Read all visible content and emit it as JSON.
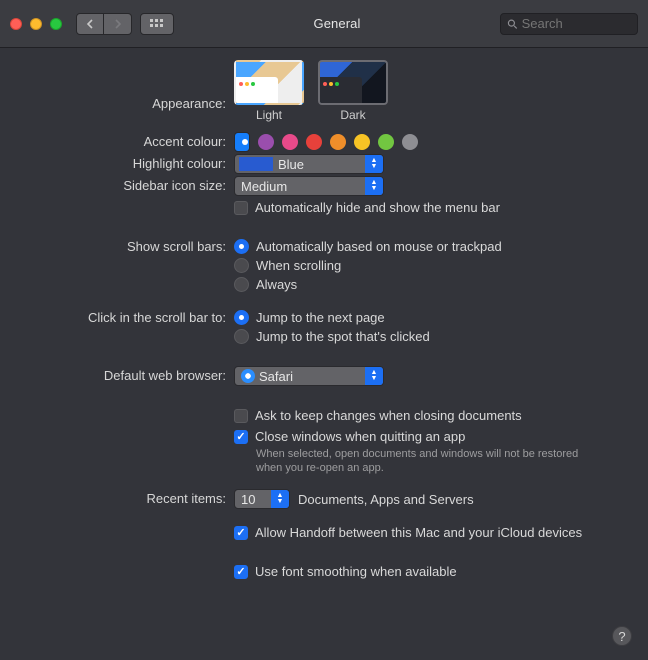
{
  "window": {
    "title": "General"
  },
  "search": {
    "placeholder": "Search"
  },
  "appearance": {
    "label": "Appearance:",
    "options": [
      {
        "name": "Light",
        "selected": false
      },
      {
        "name": "Dark",
        "selected": true
      }
    ]
  },
  "accent": {
    "label": "Accent colour:",
    "colors": [
      "#157efb",
      "#9a4ead",
      "#e84a8a",
      "#e7413b",
      "#ef8e2a",
      "#f7c325",
      "#72c641",
      "#8e8e93"
    ],
    "selected_index": 0
  },
  "highlight": {
    "label": "Highlight colour:",
    "value": "Blue",
    "swatch": "#285bd0"
  },
  "sidebar_icon": {
    "label": "Sidebar icon size:",
    "value": "Medium"
  },
  "auto_hide_menu": {
    "label": "Automatically hide and show the menu bar",
    "checked": false
  },
  "scroll_bars": {
    "label": "Show scroll bars:",
    "options": [
      "Automatically based on mouse or trackpad",
      "When scrolling",
      "Always"
    ],
    "selected_index": 0
  },
  "click_scroll": {
    "label": "Click in the scroll bar to:",
    "options": [
      "Jump to the next page",
      "Jump to the spot that's clicked"
    ],
    "selected_index": 0
  },
  "browser": {
    "label": "Default web browser:",
    "value": "Safari"
  },
  "ask_changes": {
    "label": "Ask to keep changes when closing documents",
    "checked": false
  },
  "close_windows": {
    "label": "Close windows when quitting an app",
    "checked": true,
    "hint": "When selected, open documents and windows will not be restored when you re-open an app."
  },
  "recent": {
    "label": "Recent items:",
    "value": "10",
    "suffix": "Documents, Apps and Servers"
  },
  "handoff": {
    "label": "Allow Handoff between this Mac and your iCloud devices",
    "checked": true
  },
  "font_smoothing": {
    "label": "Use font smoothing when available",
    "checked": true
  }
}
